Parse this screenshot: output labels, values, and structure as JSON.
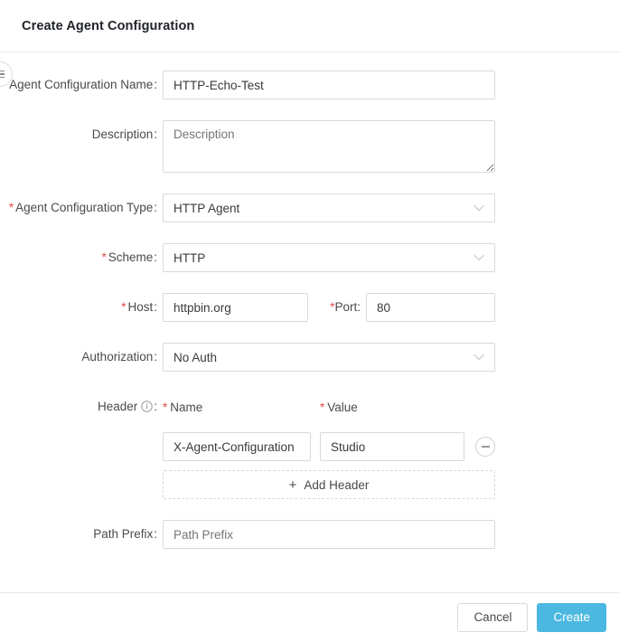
{
  "dialog": {
    "title": "Create Agent Configuration"
  },
  "side_tab": {
    "icon": "list-bars-icon"
  },
  "form": {
    "name": {
      "label": "Agent Configuration Name",
      "colon": ":",
      "required_mark": "*",
      "value": "HTTP-Echo-Test"
    },
    "description": {
      "label": "Description",
      "colon": ":",
      "placeholder": "Description",
      "value": ""
    },
    "agent_type": {
      "label": "Agent Configuration Type",
      "colon": ":",
      "required_mark": "*",
      "value": "HTTP Agent"
    },
    "scheme": {
      "label": "Scheme",
      "colon": ":",
      "required_mark": "*",
      "value": "HTTP"
    },
    "host": {
      "label": "Host",
      "colon": ":",
      "required_mark": "*",
      "value": "httpbin.org"
    },
    "port": {
      "label": "Port",
      "colon": ":",
      "required_mark": "*",
      "value": "80"
    },
    "authorization": {
      "label": "Authorization",
      "colon": ":",
      "value": "No Auth"
    },
    "header": {
      "label": "Header",
      "colon": ":",
      "info_icon": "info-circle-icon",
      "col_name_label": "Name",
      "col_name_required": "*",
      "col_value_label": "Value",
      "col_value_required": "*",
      "rows": [
        {
          "name": "X-Agent-Configuration",
          "value": "Studio",
          "remove_icon": "minus-circle-icon"
        }
      ],
      "add_label": "Add Header",
      "add_icon": "+"
    },
    "path_prefix": {
      "label": "Path Prefix",
      "colon": ":",
      "placeholder": "Path Prefix",
      "value": ""
    }
  },
  "footer": {
    "cancel_label": "Cancel",
    "create_label": "Create"
  },
  "colors": {
    "primary": "#4ab8e0",
    "required": "#e04a4a",
    "border": "#d9d9d9",
    "divider": "#e8e8e8",
    "placeholder": "#bfbfbf"
  }
}
